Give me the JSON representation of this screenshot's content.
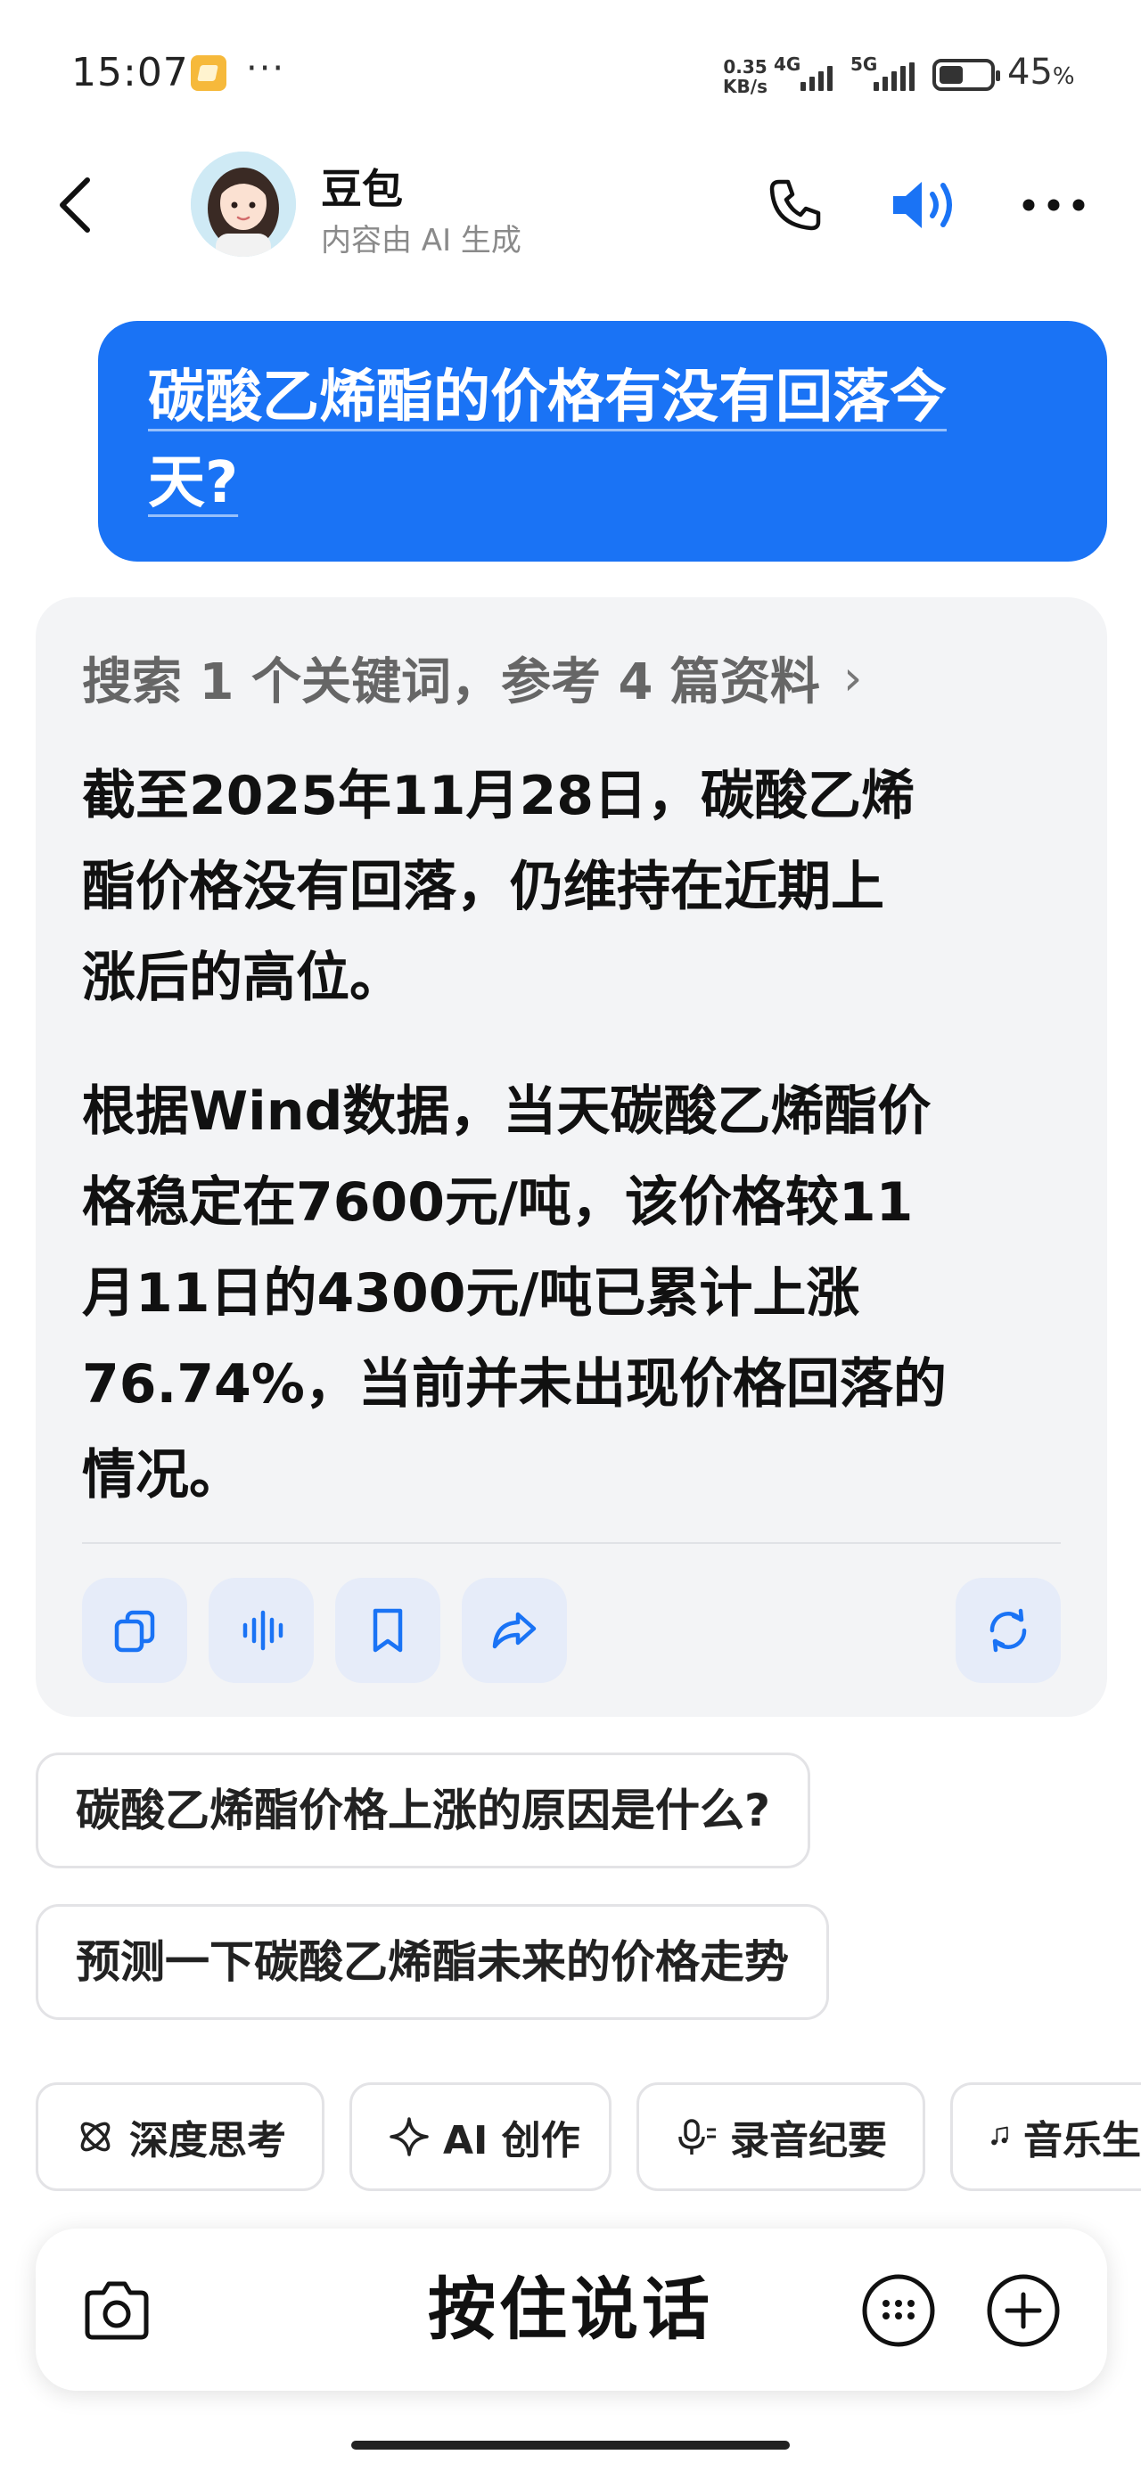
{
  "status_bar": {
    "time": "15:07",
    "more": "···",
    "net_speed_value": "0.35",
    "net_speed_unit": "KB/s",
    "network_a": "4G",
    "network_b": "5G",
    "battery_value": "45",
    "battery_unit": "%",
    "battery_level": 0.45
  },
  "header": {
    "name": "豆包",
    "subtitle": "内容由 AI 生成"
  },
  "user_message": {
    "line1": "碳酸乙烯酯的价格有没有回落今",
    "line2": "天?"
  },
  "answer": {
    "search_summary": "搜索 1 个关键词，参考 4 篇资料",
    "p1_line1": "截至2025年11月28日，碳酸乙烯",
    "p1_line2": "酯价格没有回落，仍维持在近期上",
    "p1_line3": "涨后的高位。",
    "p2_line1": "根据Wind数据，当天碳酸乙烯酯价",
    "p2_line2": "格稳定在7600元/吨，该价格较11",
    "p2_line3": "月11日的4300元/吨已累计上涨",
    "p2_line4": "76.74%，当前并未出现价格回落的",
    "p2_line5": "情况。",
    "actions": [
      "copy-icon",
      "voice-read-icon",
      "bookmark-icon",
      "share-icon",
      "regenerate-icon"
    ]
  },
  "suggestions": [
    "碳酸乙烯酯价格上涨的原因是什么?",
    "预测一下碳酸乙烯酯未来的价格走势"
  ],
  "tools": [
    {
      "label": "深度思考",
      "icon": "atom-icon"
    },
    {
      "label": "AI 创作",
      "icon": "sparkle-icon"
    },
    {
      "label": "录音纪要",
      "icon": "mic-icon"
    },
    {
      "label": "音乐生",
      "icon": "music-icon"
    }
  ],
  "input_bar": {
    "hold_to_talk": "按住说话"
  },
  "colors": {
    "accent": "#1a73f5",
    "card_bg": "#f3f4f6",
    "action_bg": "#e6ecf9"
  }
}
